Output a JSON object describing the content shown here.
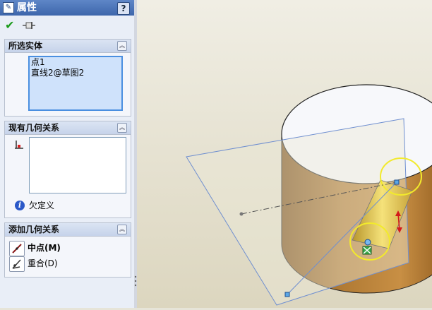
{
  "panel": {
    "title": "属性",
    "help_label": "?",
    "ok_label": "✔",
    "sections": {
      "selected": {
        "title": "所选实体",
        "items": [
          "点1",
          "直线2@草图2"
        ]
      },
      "existing": {
        "title": "现有几何关系",
        "status": "欠定义"
      },
      "add": {
        "title": "添加几何关系",
        "items": [
          {
            "label": "中点(M)",
            "icon": "midpoint-icon"
          },
          {
            "label": "重合(D)",
            "icon": "coincident-icon"
          }
        ]
      }
    }
  },
  "viewport": {
    "background_top": "#f0eee4",
    "background_bottom": "#dcd6bf",
    "cylinder_color": "#a8702c",
    "highlight_color": "#f2ea2c",
    "plane_color": "#6f8fd0"
  }
}
